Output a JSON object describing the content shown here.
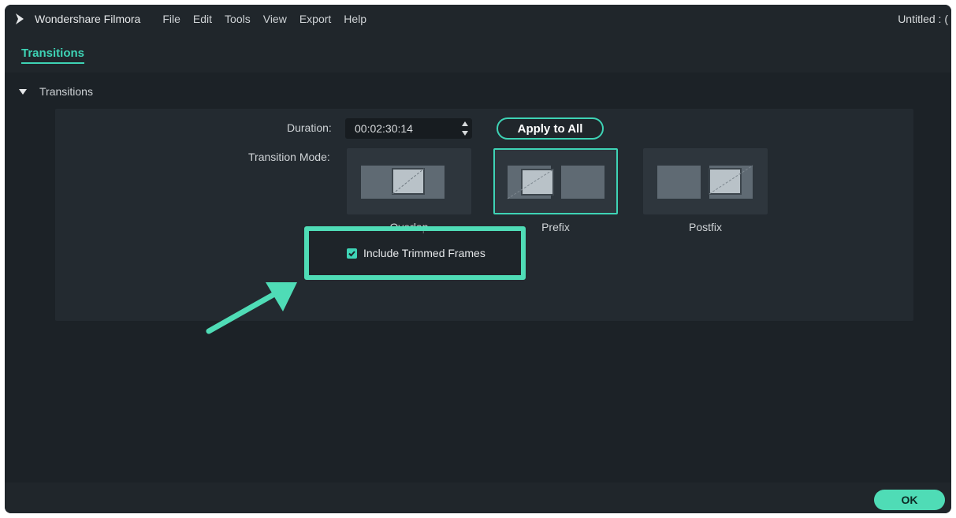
{
  "app": {
    "name": "Wondershare Filmora",
    "document_title": "Untitled : ( "
  },
  "menu": [
    "File",
    "Edit",
    "Tools",
    "View",
    "Export",
    "Help"
  ],
  "tab": {
    "label": "Transitions"
  },
  "section": {
    "title": "Transitions"
  },
  "settings": {
    "duration_label": "Duration:",
    "duration_value": "00:02:30:14",
    "apply_label": "Apply to All",
    "transition_mode_label": "Transition Mode:",
    "modes": [
      {
        "label": "Overlap",
        "selected": false
      },
      {
        "label": "Prefix",
        "selected": true
      },
      {
        "label": "Postfix",
        "selected": false
      }
    ],
    "include_trimmed_label": "Include Trimmed Frames",
    "include_trimmed_checked": true
  },
  "footer": {
    "ok_label": "OK"
  },
  "colors": {
    "accent": "#3ed3b5",
    "highlight": "#4fdcb6",
    "background": "#1a1f24"
  }
}
